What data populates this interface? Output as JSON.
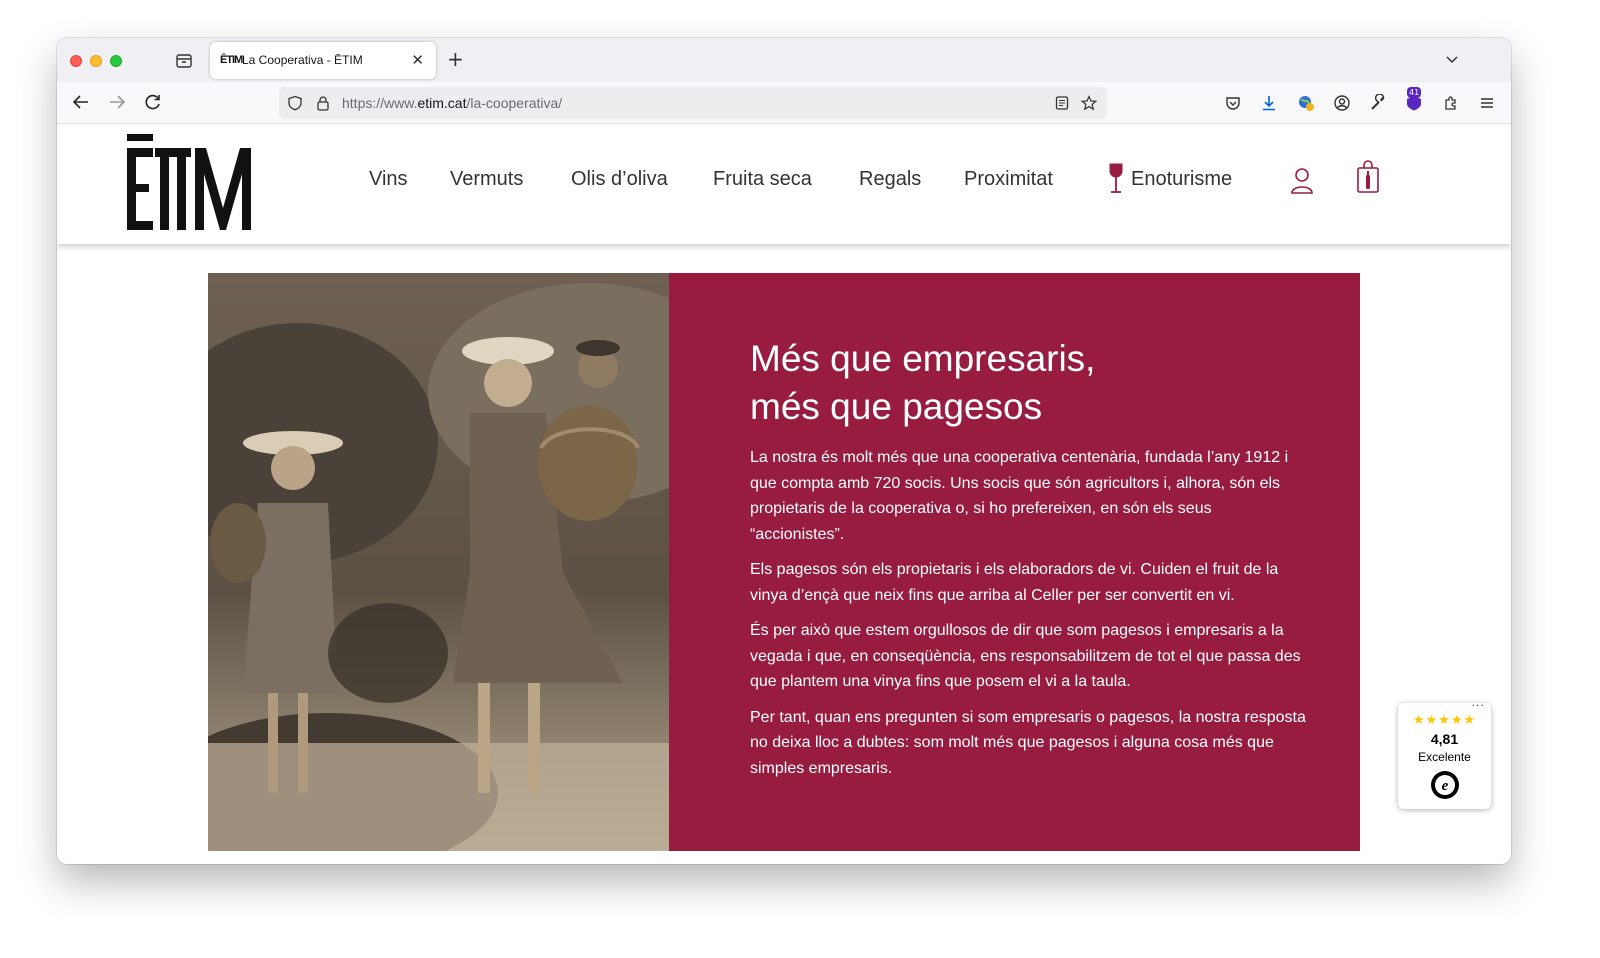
{
  "browser": {
    "tab": {
      "favicon": "ĒTIM",
      "title": "La Cooperativa - ĒTIM",
      "close": "✕"
    },
    "new_tab": "+",
    "url": {
      "prefix": "https://www.",
      "domain": "etim.cat",
      "path": "/la-cooperativa/"
    },
    "extension_badge": "41"
  },
  "site": {
    "logo_alt": "ĒTIM",
    "menu": [
      "Vins",
      "Vermuts",
      "Olis d’oliva",
      "Fruita seca",
      "Regals",
      "Proximitat",
      "Enoturisme"
    ]
  },
  "hero": {
    "title_line1": "Més que empresaris,",
    "title_line2": "més que pagesos",
    "paragraphs": [
      "La nostra és molt més que una cooperativa centenària, fundada l’any 1912 i que compta amb 720 socis. Uns socis que són agricultors i, alhora, són els propietaris de la cooperativa o, si ho prefereixen, en són els seus “accionistes”.",
      "Els pagesos són els propietaris i els elaboradors de vi. Cuiden el fruit de la vinya d’ençà que neix fins que arriba al Celler per ser convertit en vi.",
      "És per això que estem orgullosos de dir que som pagesos i empresaris a la vegada i que, en conseqüència, ens responsabilitzem de tot el que passa des que plantem una vinya fins que posem el vi a la taula.",
      "Per tant, quan ens pregunten si som empresaris o pagesos, la nostra resposta no deixa lloc a dubtes: som molt més que pagesos i alguna cosa més que simples empresaris."
    ],
    "panel_color": "#971c40"
  },
  "trusted": {
    "dots": "···",
    "stars": "★★★★★",
    "score": "4,81",
    "label": "Excelente"
  }
}
